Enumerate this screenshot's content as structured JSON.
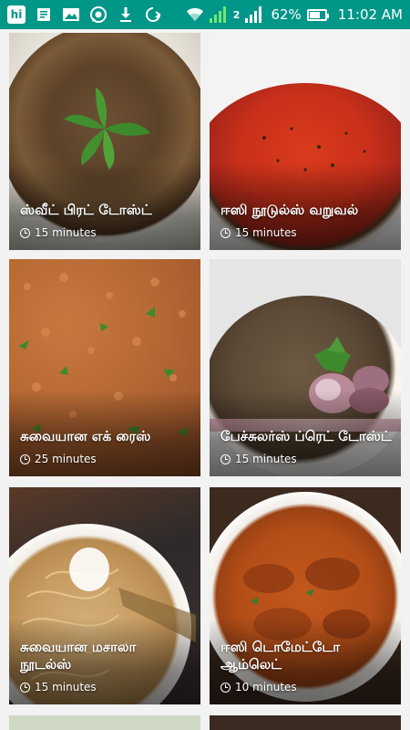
{
  "statusbar": {
    "left_icons": [
      "hike-icon",
      "notes-icon",
      "gallery-icon",
      "whatsapp-icon",
      "download-icon",
      "sync-icon"
    ],
    "hike_label": "hi",
    "sim2_label": "2",
    "battery": "62%",
    "battery_level": 0.62,
    "time": "11:02 AM"
  },
  "recipes": [
    {
      "title": "ஸ்வீட் பிரட் டோஸ்ட்",
      "time": "15 minutes"
    },
    {
      "title": "ஈஸி நூடுல்ஸ் வறுவல்",
      "time": "15 minutes"
    },
    {
      "title": "சுவையான எக் ரைஸ்",
      "time": "25 minutes"
    },
    {
      "title": "பேச்சுலர்ஸ் ப்ரெட் டோஸ்ட்",
      "time": "15 minutes"
    },
    {
      "title": "சுவையான மசாலா நூடல்ஸ்",
      "time": "15 minutes"
    },
    {
      "title": "ஈஸி டொமேட்டோ ஆம்லெட்",
      "time": "10 minutes"
    }
  ],
  "colors": {
    "statusbar": "#009688",
    "background": "#f2f2f2"
  }
}
